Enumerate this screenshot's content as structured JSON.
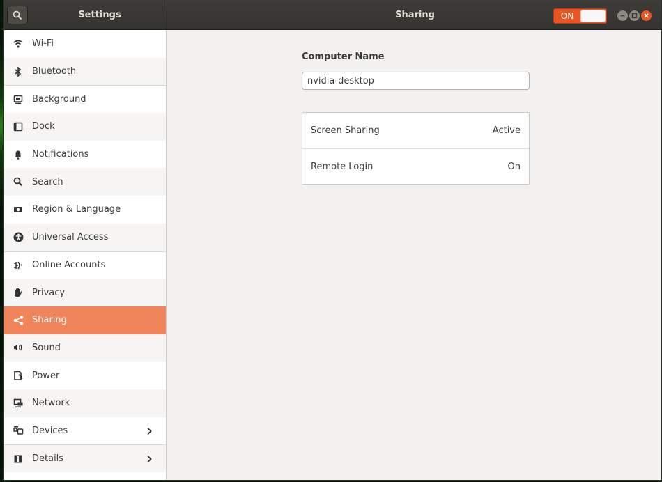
{
  "header": {
    "app_title": "Settings",
    "page_title": "Sharing",
    "master_switch": {
      "label": "ON",
      "state": "on"
    }
  },
  "sidebar": {
    "items": [
      {
        "label": "Wi-Fi",
        "icon": "wifi-icon"
      },
      {
        "label": "Bluetooth",
        "icon": "bluetooth-icon"
      },
      {
        "label": "Background",
        "icon": "background-icon"
      },
      {
        "label": "Dock",
        "icon": "dock-icon"
      },
      {
        "label": "Notifications",
        "icon": "bell-icon"
      },
      {
        "label": "Search",
        "icon": "search-icon"
      },
      {
        "label": "Region & Language",
        "icon": "region-icon"
      },
      {
        "label": "Universal Access",
        "icon": "accessibility-icon"
      },
      {
        "label": "Online Accounts",
        "icon": "online-accounts-icon"
      },
      {
        "label": "Privacy",
        "icon": "hand-icon"
      },
      {
        "label": "Sharing",
        "icon": "share-icon",
        "active": true
      },
      {
        "label": "Sound",
        "icon": "speaker-icon"
      },
      {
        "label": "Power",
        "icon": "power-icon"
      },
      {
        "label": "Network",
        "icon": "network-icon"
      },
      {
        "label": "Devices",
        "icon": "devices-icon",
        "has_submenu": true
      },
      {
        "label": "Details",
        "icon": "info-icon",
        "has_submenu": true
      }
    ]
  },
  "sharing": {
    "computer_name_label": "Computer Name",
    "computer_name_value": "nvidia-desktop",
    "services": [
      {
        "name": "Screen Sharing",
        "status": "Active"
      },
      {
        "name": "Remote Login",
        "status": "On"
      }
    ]
  },
  "colors": {
    "accent": "#e95420",
    "sidebar_active": "#f0845a",
    "headerbar": "#3a3935"
  }
}
